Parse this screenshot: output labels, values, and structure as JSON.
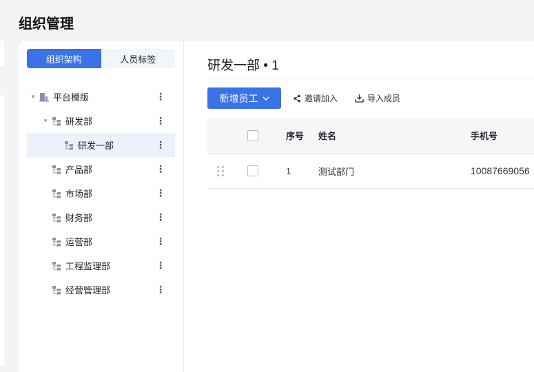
{
  "page": {
    "title": "组织管理"
  },
  "tabs": [
    {
      "label": "组织架构",
      "active": true
    },
    {
      "label": "人员标签",
      "active": false
    }
  ],
  "tree": [
    {
      "label": "平台模版",
      "level": 0,
      "expanded": true,
      "icon": "building-icon"
    },
    {
      "label": "研发部",
      "level": 1,
      "expanded": true,
      "icon": "org-icon"
    },
    {
      "label": "研发一部",
      "level": 2,
      "selected": true,
      "icon": "org-icon"
    },
    {
      "label": "产品部",
      "level": 1,
      "icon": "org-icon"
    },
    {
      "label": "市场部",
      "level": 1,
      "icon": "org-icon"
    },
    {
      "label": "财务部",
      "level": 1,
      "icon": "org-icon"
    },
    {
      "label": "运营部",
      "level": 1,
      "icon": "org-icon"
    },
    {
      "label": "工程监理部",
      "level": 1,
      "icon": "org-icon"
    },
    {
      "label": "经营管理部",
      "level": 1,
      "icon": "org-icon"
    }
  ],
  "main": {
    "heading": "研发一部 • 1",
    "add_button": "新增员工",
    "invite": "邀请加入",
    "import": "导入成员"
  },
  "table": {
    "headers": [
      "序号",
      "姓名",
      "手机号"
    ],
    "rows": [
      {
        "index": "1",
        "name": "测试部门",
        "phone": "10087669056"
      }
    ]
  },
  "colors": {
    "accent": "#3a72e8"
  }
}
